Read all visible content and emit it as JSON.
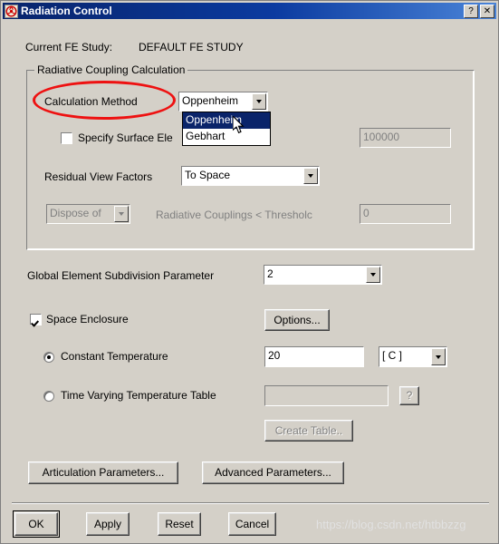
{
  "window": {
    "title": "Radiation Control",
    "icon": "radiation-icon",
    "help_button": "?",
    "close_button": "✕"
  },
  "study": {
    "label": "Current FE Study:",
    "value": "DEFAULT FE STUDY"
  },
  "radiative_group": {
    "title": "Radiative Coupling Calculation",
    "calculation_method": {
      "label": "Calculation Method",
      "value": "Oppenheim",
      "options": [
        "Oppenheim",
        "Gebhart"
      ],
      "selected_option": "Oppenheim",
      "expanded": true,
      "annotated": true,
      "annotation_color": "#ee1111"
    },
    "specify_surface": {
      "label": "Specify Surface Ele",
      "checked": false,
      "value": "100000",
      "enabled": false
    },
    "residual_view_factors": {
      "label": "Residual View Factors",
      "value": "To Space",
      "options": [
        "To Space"
      ]
    },
    "dispose": {
      "combo_value": "Dispose of",
      "enabled": false,
      "threshold_label": "Radiative Couplings < Thresholc",
      "threshold_value": "0"
    }
  },
  "subdivision": {
    "label": "Global Element Subdivision Parameter",
    "value": "2"
  },
  "space_enclosure": {
    "label": "Space Enclosure",
    "checked": true,
    "options_button": "Options..."
  },
  "temperature": {
    "constant": {
      "label": "Constant Temperature",
      "selected": true,
      "value": "20",
      "unit": "[ C ]",
      "unit_options": [
        "[ C ]"
      ]
    },
    "time_varying": {
      "label": "Time Varying Temperature Table",
      "selected": false,
      "value": "",
      "help_button": "?",
      "enabled": false
    },
    "create_table_button": "Create Table..",
    "create_table_enabled": false
  },
  "parameter_buttons": {
    "articulation": "Articulation Parameters...",
    "advanced": "Advanced Parameters..."
  },
  "footer": {
    "ok": "OK",
    "apply": "Apply",
    "reset": "Reset",
    "cancel": "Cancel"
  },
  "watermark": "https://blog.csdn.net/htbbzzg"
}
